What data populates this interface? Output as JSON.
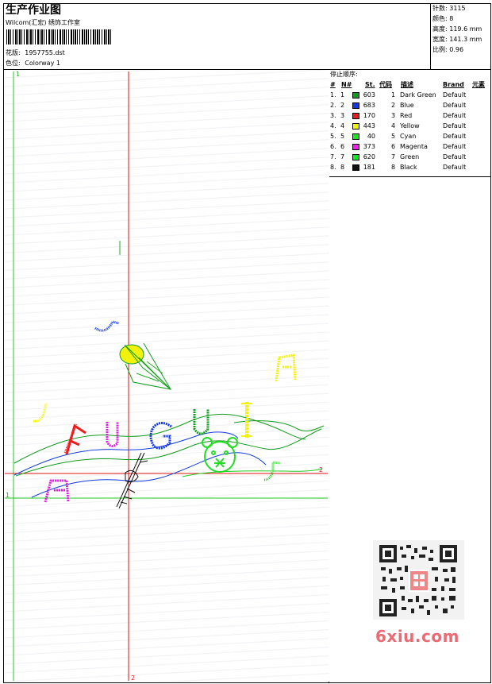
{
  "header": {
    "title": "生产作业图",
    "studio": "Wilcom(汇宏) 绣饰工作室",
    "design_label": "花版:",
    "design_value": "1957755.dst",
    "colorway_label": "色位:",
    "colorway_value": "Colorway 1"
  },
  "stats": {
    "stitches_label": "针数:",
    "stitches_value": "3115",
    "colors_label": "颜色:",
    "colors_value": "8",
    "height_label": "高度:",
    "height_value": "119.6 mm",
    "width_label": "宽度:",
    "width_value": "141.3 mm",
    "scale_label": "比例:",
    "scale_value": "0.96"
  },
  "sequence": {
    "title": "停止顺序:",
    "columns": [
      "#",
      "N#",
      "St.",
      "代码",
      "描述",
      "Brand",
      "元素"
    ],
    "rows": [
      {
        "num": "1.",
        "needle": "1",
        "color": "#0f9b1b",
        "stitches": "603",
        "code": "1",
        "desc": "Dark Green",
        "brand": "Default"
      },
      {
        "num": "2.",
        "needle": "2",
        "color": "#1239e6",
        "stitches": "683",
        "code": "2",
        "desc": "Blue",
        "brand": "Default"
      },
      {
        "num": "3.",
        "needle": "3",
        "color": "#ee1c1c",
        "stitches": "170",
        "code": "3",
        "desc": "Red",
        "brand": "Default"
      },
      {
        "num": "4.",
        "needle": "4",
        "color": "#f2f20c",
        "stitches": "443",
        "code": "4",
        "desc": "Yellow",
        "brand": "Default"
      },
      {
        "num": "5.",
        "needle": "5",
        "color": "#22e022",
        "stitches": "40",
        "code": "5",
        "desc": "Cyan",
        "brand": "Default"
      },
      {
        "num": "6.",
        "needle": "6",
        "color": "#ee22e6",
        "stitches": "373",
        "code": "6",
        "desc": "Magenta",
        "brand": "Default"
      },
      {
        "num": "7.",
        "needle": "7",
        "color": "#11ea22",
        "stitches": "620",
        "code": "7",
        "desc": "Green",
        "brand": "Default"
      },
      {
        "num": "8.",
        "needle": "8",
        "color": "#111111",
        "stitches": "181",
        "code": "8",
        "desc": "Black",
        "brand": "Default"
      }
    ]
  },
  "artwork": {
    "letters": [
      "F",
      "U",
      "G",
      "U",
      "I"
    ],
    "axis_v1_top": "1",
    "axis_v1_left": "1",
    "axis_h2_right": "2",
    "axis_v2_bottom": "2"
  },
  "watermark": {
    "text": "6xiu.com"
  }
}
